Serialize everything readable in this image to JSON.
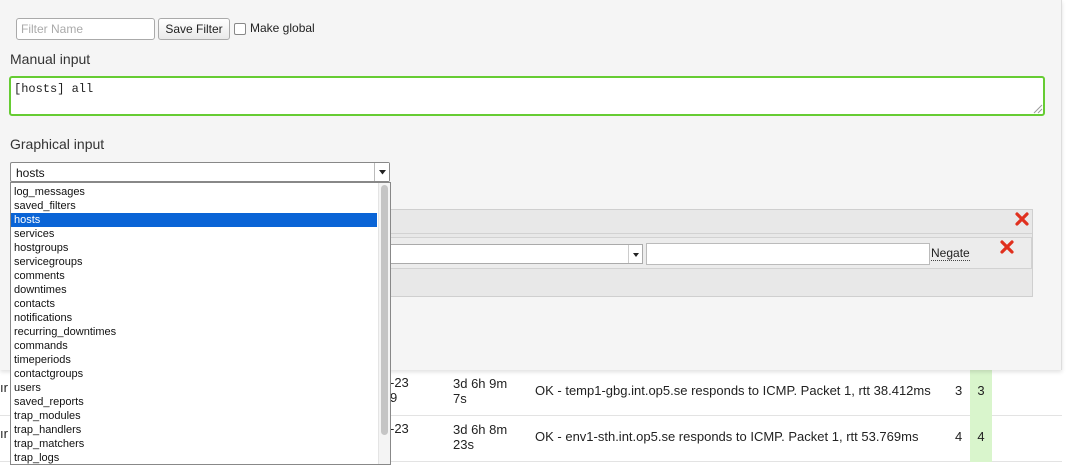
{
  "filter_bar": {
    "name_placeholder": "Filter Name",
    "save_label": "Save Filter",
    "make_global_label": "Make global",
    "make_global_checked": false
  },
  "manual_input": {
    "title": "Manual input",
    "value": "[hosts] all"
  },
  "graphical_input": {
    "title": "Graphical input",
    "selected_table": "hosts",
    "options": [
      "log_messages",
      "saved_filters",
      "hosts",
      "services",
      "hostgroups",
      "servicegroups",
      "comments",
      "downtimes",
      "contacts",
      "notifications",
      "recurring_downtimes",
      "commands",
      "timeperiods",
      "contactgroups",
      "users",
      "saved_reports",
      "trap_modules",
      "trap_handlers",
      "trap_matchers",
      "trap_logs"
    ],
    "rule": {
      "negate_label": "Negate",
      "delete_icon": "red-x-icon"
    },
    "group": {
      "delete_icon": "red-x-icon"
    }
  },
  "table_rows": [
    {
      "host_fragment": "ır",
      "date_fragment_top": "-23",
      "date_fragment_bottom": "9",
      "duration_line1": "3d 6h 9m",
      "duration_line2": "7s",
      "output": "OK - temp1-gbg.int.op5.se responds to ICMP. Packet 1, rtt 38.412ms",
      "attempt": "3",
      "current": "3"
    },
    {
      "host_fragment": "ır",
      "date_fragment_top": "-23",
      "date_fragment_bottom": "",
      "duration_line1": "3d 6h 8m",
      "duration_line2": "23s",
      "output": "OK - env1-sth.int.op5.se responds to ICMP. Packet 1, rtt 53.769ms",
      "attempt": "4",
      "current": "4"
    }
  ],
  "colors": {
    "textarea_border": "#66cc33",
    "selected_option_bg": "#0a64d6",
    "current_cell_bg": "#d9f5cc",
    "delete_icon": "#e0301e"
  }
}
